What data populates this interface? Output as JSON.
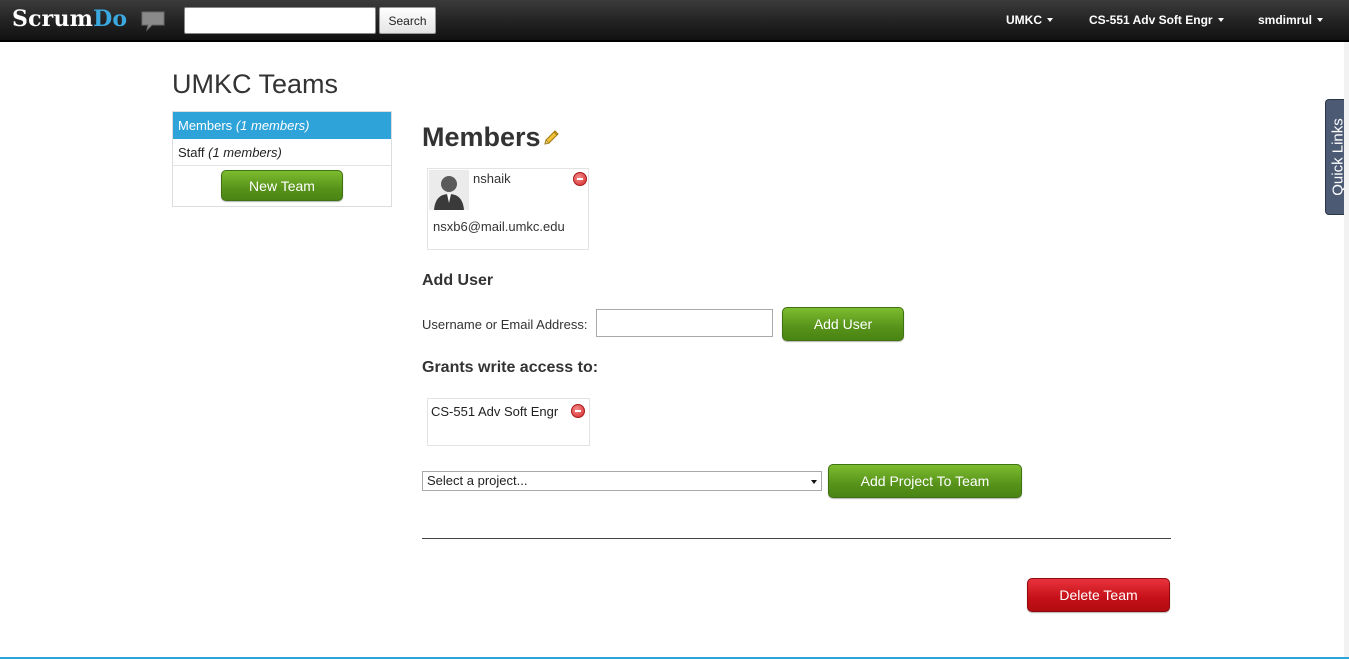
{
  "topbar": {
    "logo_main": "Scrum",
    "logo_accent": "Do",
    "search_placeholder": "",
    "search_button": "Search",
    "nav": [
      {
        "label": "UMKC"
      },
      {
        "label": "CS-551 Adv Soft Engr"
      },
      {
        "label": "smdimrul"
      }
    ]
  },
  "sidebar": {
    "title": "UMKC Teams",
    "teams": [
      {
        "name": "Members",
        "count": "(1 members)",
        "active": true
      },
      {
        "name": "Staff",
        "count": "(1 members)",
        "active": false
      }
    ],
    "new_team_button": "New Team"
  },
  "main": {
    "title": "Members",
    "members": [
      {
        "username": "nshaik",
        "email": "nsxb6@mail.umkc.edu"
      }
    ],
    "add_user": {
      "heading": "Add User",
      "label": "Username or Email Address:",
      "value": "",
      "button": "Add User"
    },
    "grants": {
      "heading": "Grants write access to:",
      "projects": [
        "CS-551 Adv Soft Engr"
      ],
      "select_value": "Select a project...",
      "add_button": "Add Project To Team"
    },
    "delete_button": "Delete Team"
  },
  "quick_links": "Quick Links",
  "colors": {
    "accent": "#2ea3da",
    "green_button": "#57931a",
    "red_button": "#c51018",
    "topbar": "#222222"
  }
}
